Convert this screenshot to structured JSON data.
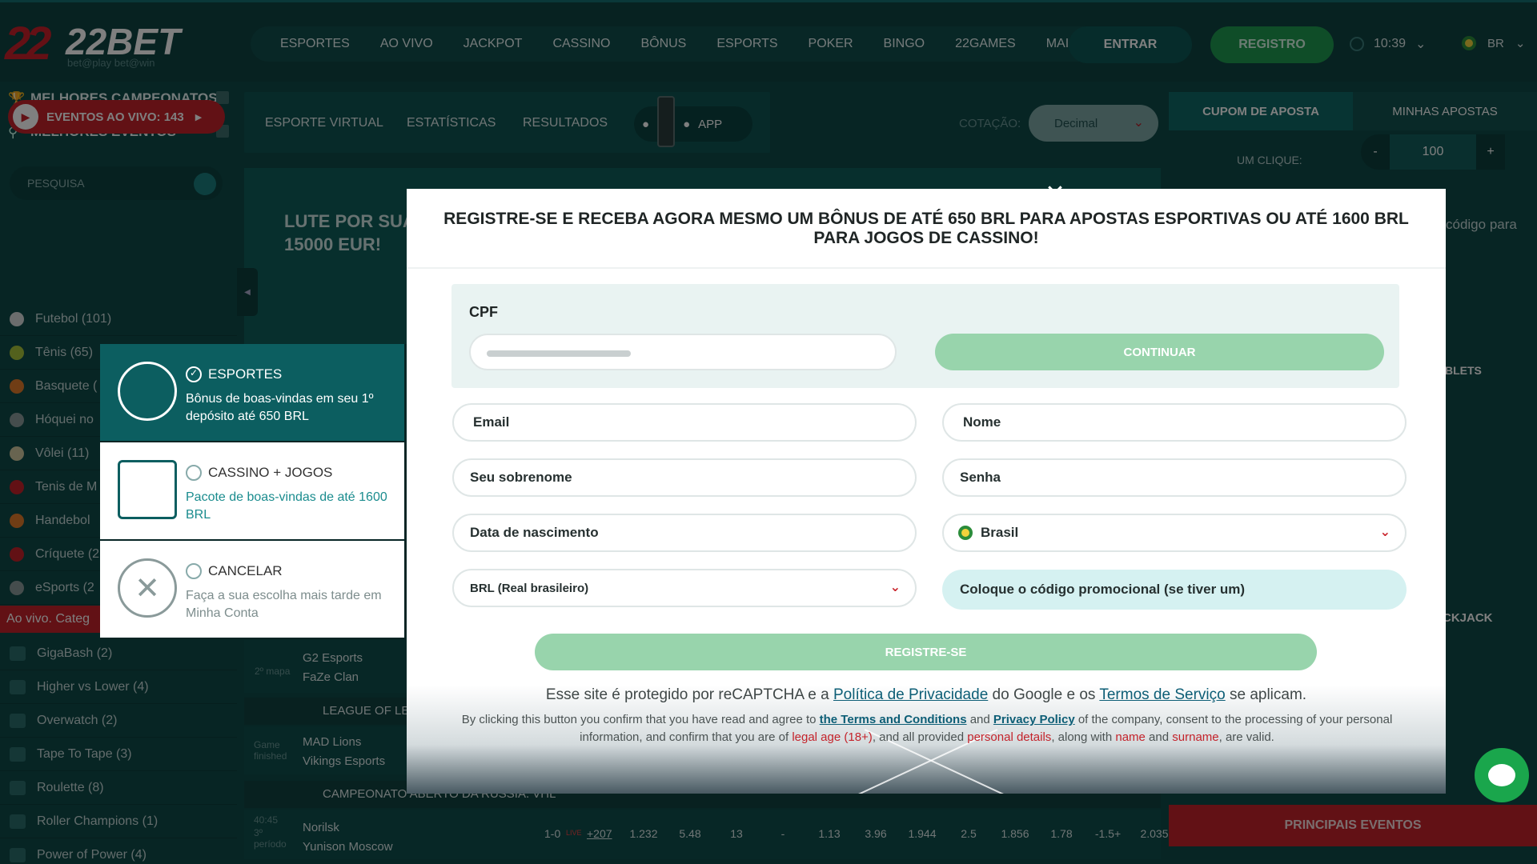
{
  "header": {
    "logo_main": "22BET",
    "logo_sub": "bet@play bet@win",
    "nav": [
      "ESPORTES",
      "AO VIVO",
      "JACKPOT",
      "CASSINO",
      "BÔNUS",
      "ESPORTS",
      "POKER",
      "BINGO",
      "22GAMES",
      "MAIS"
    ],
    "login_label": "ENTRAR",
    "register_label": "REGISTRO",
    "time": "10:39",
    "language": "BR",
    "chevron": "⌄"
  },
  "left_sidebar": {
    "top_championships": "MELHORES CAMPEONATOS",
    "top_events": "MELHORES EVENTOS",
    "live_events": "EVENTOS AO VIVO: 143",
    "search_placeholder": "PESQUISA",
    "sports": [
      {
        "label": "Futebol (101)",
        "color": "#d6dada"
      },
      {
        "label": "Tênis (65)",
        "color": "#a6c23a"
      },
      {
        "label": "Basquete (",
        "color": "#e07a2a"
      },
      {
        "label": "Hóquei no",
        "color": "#8a9a9a"
      },
      {
        "label": "Vôlei (11)",
        "color": "#d0c8a0"
      },
      {
        "label": "Tenis de M",
        "color": "#c4232b"
      },
      {
        "label": "Handebol",
        "color": "#e07a2a"
      },
      {
        "label": "Críquete (2",
        "color": "#c4232b"
      },
      {
        "label": "eSports (2",
        "color": "#8a9a9a"
      }
    ],
    "live_category": "Ao vivo. Categ",
    "categories": [
      "GigaBash (2)",
      "Higher vs Lower (4)",
      "Overwatch (2)",
      "Tape To Tape (3)",
      "Roulette (8)",
      "Roller Champions (1)",
      "Power of Power (4)"
    ]
  },
  "subnav": {
    "items": [
      "ESPORTE VIRTUAL",
      "ESTATÍSTICAS",
      "RESULTADOS"
    ],
    "app_label": "APP",
    "cotacao_label": "COTAÇÃO:",
    "odds_format": "Decimal"
  },
  "banner": {
    "line1": "LUTE POR SUA",
    "line2": "15000 EUR!"
  },
  "games": [
    {
      "map": "2º mapa",
      "team1": "G2 Esports",
      "team2": "FaZe Clan"
    },
    {
      "league": "LEAGUE OF LE"
    },
    {
      "status": "Game finished",
      "team1": "MAD Lions",
      "team2": "Vikings Esports"
    },
    {
      "league": "CAMPEONATO ABERTO DA RÚSSIA. VHL"
    },
    {
      "time": "40:45",
      "period": "3º período",
      "team1": "Norilsk",
      "team2": "Yunison Moscow",
      "score": "1-0",
      "live": "LIVE",
      "more": "+207",
      "odds": [
        "1.232",
        "5.48",
        "13",
        "-",
        "1.13",
        "3.96",
        "1.944",
        "2.5",
        "1.856",
        "1.78",
        "-1.5+",
        "2.035"
      ]
    }
  ],
  "right_sidebar": {
    "tab_coupon": "CUPOM DE APOSTA",
    "tab_my_bets": "MINHAS APOSTAS",
    "one_click": "UM CLIQUE:",
    "minus": "-",
    "stake": "100",
    "plus": "+",
    "code_partial": "código para",
    "blets": "BLETS",
    "blackjack": "CKJACK",
    "principais": "PRINCIPAIS EVENTOS"
  },
  "bonus_picker": [
    {
      "title": "ESPORTES",
      "desc": "Bônus de boas-vindas em seu 1º depósito até 650 BRL",
      "selected": true
    },
    {
      "title": "CASSINO + JOGOS",
      "desc": "Pacote de boas-vindas de até 1600 BRL",
      "selected": false
    },
    {
      "title": "CANCELAR",
      "desc": "Faça a sua escolha mais tarde em Minha Conta",
      "selected": false
    }
  ],
  "modal": {
    "title": "REGISTRE-SE E RECEBA AGORA MESMO UM BÔNUS DE ATÉ 650 BRL PARA APOSTAS ESPORTIVAS OU ATÉ 1600 BRL PARA JOGOS DE CASSINO!",
    "close": "✕",
    "cpf_label": "CPF",
    "cpf_button": "CONTINUAR",
    "email": "Email",
    "name": "Nome",
    "surname": "Seu sobrenome",
    "password": "Senha",
    "birthdate": "Data de nascimento",
    "country": "Brasil",
    "currency": "BRL (Real brasileiro)",
    "promo": "Coloque o código promocional (se tiver um)",
    "register": "REGISTRE-SE",
    "recap_1": "Esse site é protegido por reCAPTCHA e a ",
    "recap_link1": "Política de Privacidade",
    "recap_2": " do Google e os ",
    "recap_link2": "Termos de Serviço",
    "recap_3": " se aplicam.",
    "terms_1": "By clicking this button you confirm that you have read and agree to ",
    "terms_link1": "the Terms and Conditions",
    "terms_2": " and ",
    "terms_link2": "Privacy Policy",
    "terms_3": " of the company, consent to the processing of your personal information, and confirm that you are of ",
    "terms_red1": "legal age (18+)",
    "terms_4": ", and all provided ",
    "terms_red2": "personal details",
    "terms_5": ", along with ",
    "terms_red3": "name",
    "terms_6": " and ",
    "terms_red4": "surname",
    "terms_7": ", are valid."
  }
}
